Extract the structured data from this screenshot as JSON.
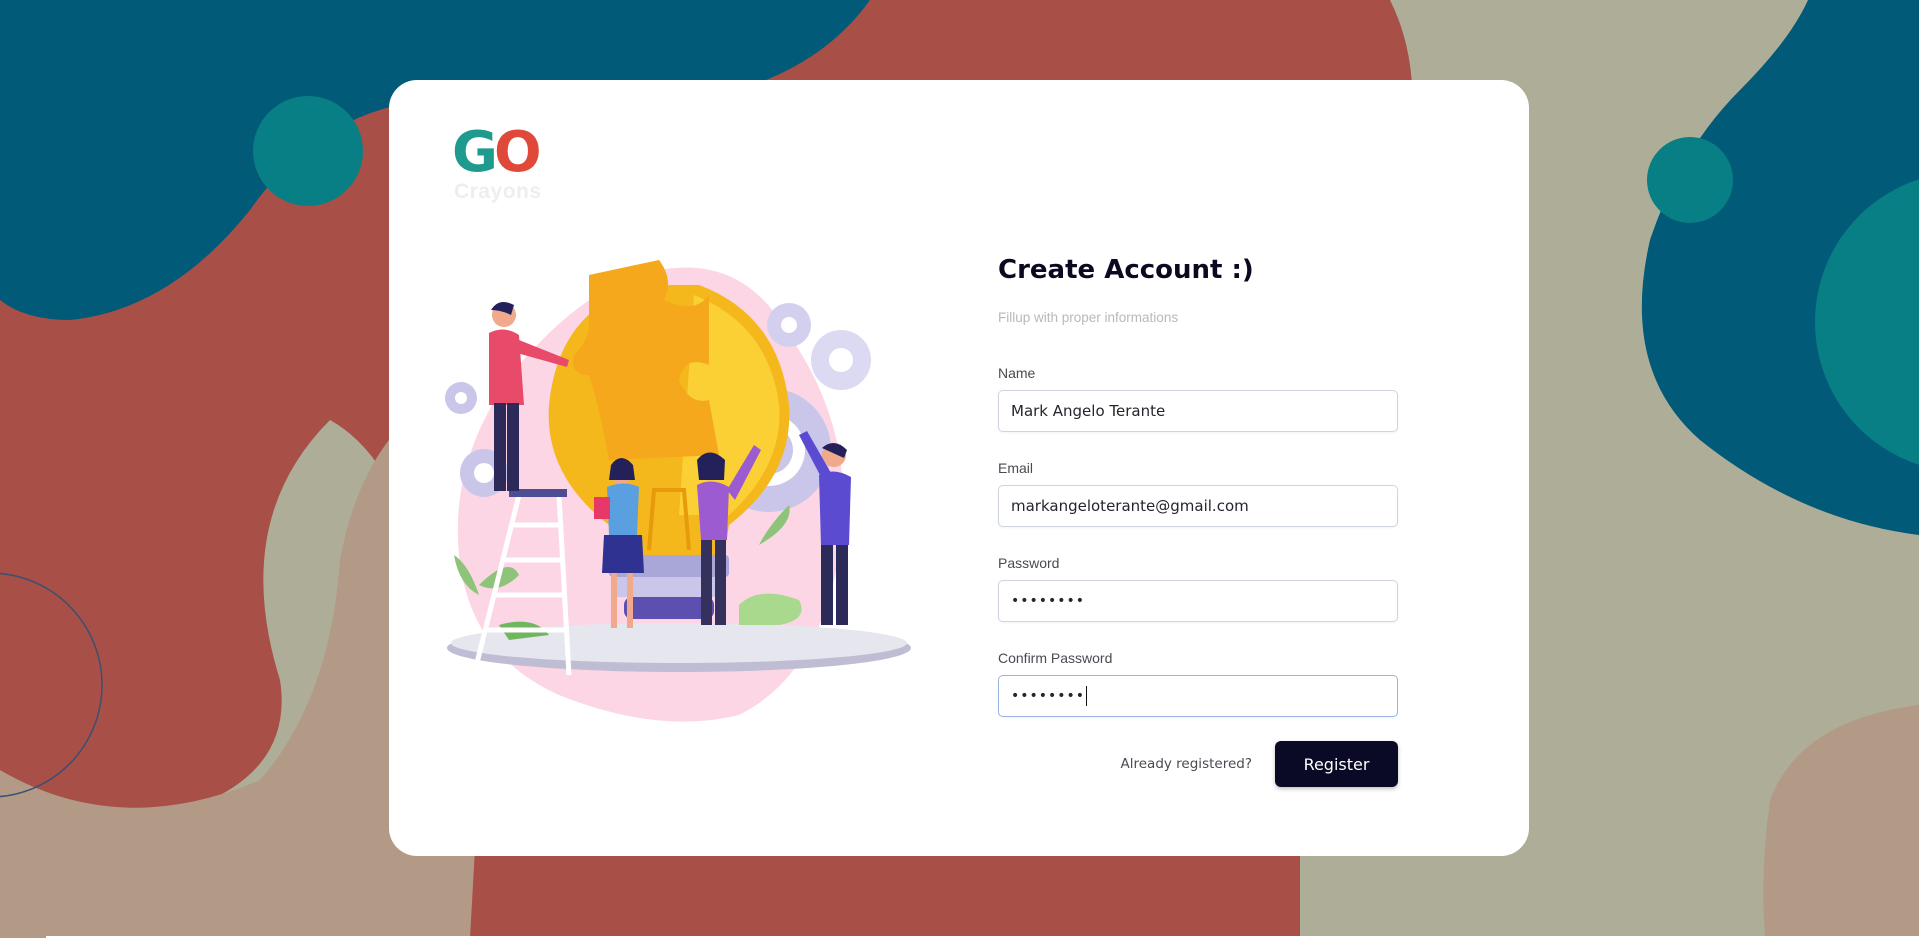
{
  "brand": {
    "logo_text": "GO",
    "logo_g": "G",
    "logo_o": "O",
    "logo_subtitle": "Crayons"
  },
  "colors": {
    "teal_dark": "#015a78",
    "red_brown": "#a84f47",
    "beige": "#aeae98",
    "tan": "#b39a86",
    "teal": "#087f84",
    "button_bg": "#0b0a26",
    "accent_yellow": "#f5b81c"
  },
  "form": {
    "title": "Create Account :)",
    "subtitle": "Fillup with proper informations",
    "fields": {
      "name": {
        "label": "Name",
        "value": "Mark Angelo Terante"
      },
      "email": {
        "label": "Email",
        "value": "markangeloterante@gmail.com"
      },
      "password": {
        "label": "Password",
        "value": "••••••••"
      },
      "confirm_password": {
        "label": "Confirm Password",
        "value": "••••••••"
      }
    },
    "already_registered": "Already registered?",
    "register_button": "Register"
  }
}
